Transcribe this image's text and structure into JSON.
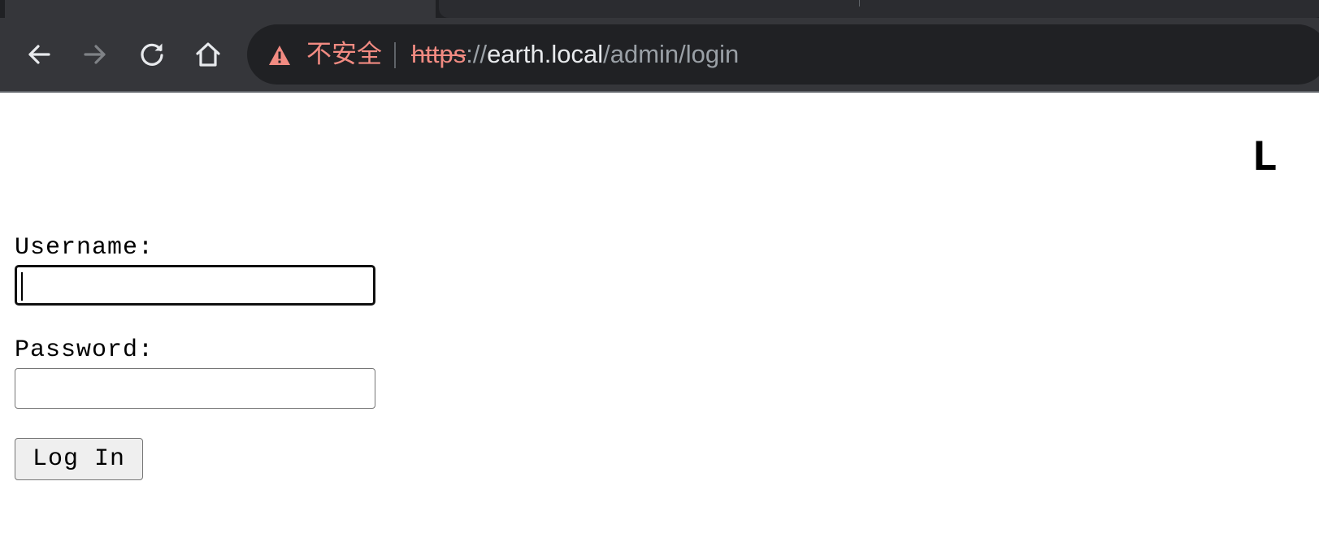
{
  "browser": {
    "toolbar": {
      "back_icon": "arrow-left-icon",
      "forward_icon": "arrow-right-icon",
      "reload_icon": "reload-icon",
      "home_icon": "home-icon"
    },
    "omnibox": {
      "security_icon": "warning-triangle-icon",
      "security_label": "不安全",
      "url_scheme": "https",
      "url_separator": "://",
      "url_host": "earth.local",
      "url_path": "/admin/login"
    },
    "colors": {
      "chrome_bg": "#35363a",
      "omnibox_bg": "#202124",
      "warning": "#f28b82"
    }
  },
  "page": {
    "heading_visible": "L",
    "form": {
      "username_label": "Username:",
      "username_value": "",
      "password_label": "Password:",
      "password_value": "",
      "submit_label": "Log In"
    }
  }
}
